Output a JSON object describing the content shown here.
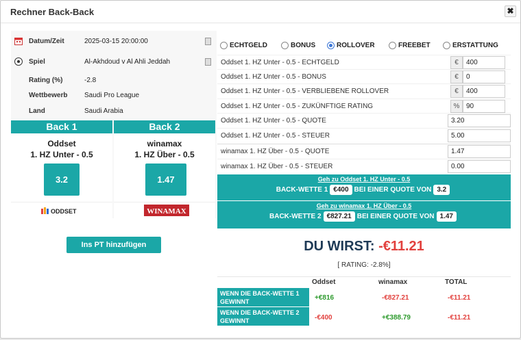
{
  "window": {
    "title": "Rechner Back-Back",
    "close_symbol": "✖"
  },
  "info": {
    "rows": [
      {
        "label": "Datum/Zeit",
        "value": "2025-03-15 20:00:00",
        "icon": "calendar-icon",
        "has_copy": true
      },
      {
        "label": "Spiel",
        "value": "Al-Akhdoud v Al Ahli Jeddah",
        "icon": "soccer-ball-icon",
        "has_copy": true
      },
      {
        "label": "Rating (%)",
        "value": "-2.8",
        "icon": "",
        "has_copy": false
      },
      {
        "label": "Wettbewerb",
        "value": "Saudi Pro League",
        "icon": "",
        "has_copy": false
      },
      {
        "label": "Land",
        "value": "Saudi Arabia",
        "icon": "",
        "has_copy": false
      }
    ]
  },
  "backs": [
    {
      "head": "Back 1",
      "bookmaker": "Oddset",
      "market": "1. HZ Unter - 0.5",
      "odds": "3.2",
      "logo": "ODDSET"
    },
    {
      "head": "Back 2",
      "bookmaker": "winamax",
      "market": "1. HZ Über - 0.5",
      "odds": "1.47",
      "logo": "WINAMAX"
    }
  ],
  "add_pt_label": "Ins PT hinzufügen",
  "bonus_types": [
    {
      "label": "ECHTGELD",
      "selected": false
    },
    {
      "label": "BONUS",
      "selected": false
    },
    {
      "label": "ROLLOVER",
      "selected": true
    },
    {
      "label": "FREEBET",
      "selected": false
    },
    {
      "label": "ERSTATTUNG",
      "selected": false
    }
  ],
  "fields": [
    {
      "label": "Oddset 1. HZ Unter - 0.5 - ECHTGELD",
      "addon": "€",
      "value": "400"
    },
    {
      "label": "Oddset 1. HZ Unter - 0.5 - BONUS",
      "addon": "€",
      "value": "0"
    },
    {
      "label": "Oddset 1. HZ Unter - 0.5 - VERBLIEBENE ROLLOVER",
      "addon": "€",
      "value": "400"
    },
    {
      "label": "Oddset 1. HZ Unter - 0.5 - ZUKÜNFTIGE RATING",
      "addon": "%",
      "value": "90"
    },
    {
      "label": "Oddset 1. HZ Unter - 0.5 - QUOTE",
      "addon": "",
      "value": "3.20"
    },
    {
      "label": "Oddset 1. HZ Unter - 0.5 - STEUER",
      "addon": "",
      "value": "5.00"
    },
    {
      "label": "winamax 1. HZ Über - 0.5  - QUOTE",
      "addon": "",
      "value": "1.47"
    },
    {
      "label": "winamax 1. HZ Über - 0.5 - STEUER",
      "addon": "",
      "value": "0.00"
    }
  ],
  "bets": [
    {
      "link": "Geh zu Oddset 1. HZ Unter - 0.5",
      "prefix": "BACK-WETTE 1",
      "stake": "€400",
      "mid": "BEI EINER QUOTE VON",
      "odds": "3.2"
    },
    {
      "link": "Geh zu winamax 1. HZ Über - 0.5",
      "prefix": "BACK-WETTE 2",
      "stake": "€827.21",
      "mid": "BEI EINER QUOTE VON",
      "odds": "1.47"
    }
  ],
  "result": {
    "prefix": "DU WIRST:",
    "amount": "-€11.21",
    "rating": "[ RATING: -2.8%]"
  },
  "table": {
    "headers": [
      "Oddset",
      "winamax",
      "TOTAL"
    ],
    "rows": [
      {
        "label": "WENN DIE BACK-WETTE 1 GEWINNT",
        "values": [
          "+€816",
          "-€827.21",
          "-€11.21"
        ]
      },
      {
        "label": "WENN DIE BACK-WETTE 2 GEWINNT",
        "values": [
          "-€400",
          "+€388.79",
          "-€11.21"
        ]
      }
    ]
  },
  "colors": {
    "accent": "#1ba7a7",
    "negative": "#e2413e",
    "positive": "#2d9a2d",
    "heading": "#1e3a56"
  }
}
